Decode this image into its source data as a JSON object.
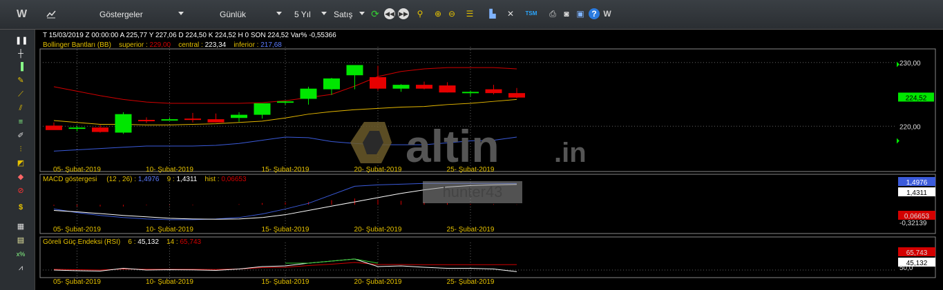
{
  "toolbar": {
    "logo": "W",
    "indicators_label": "Göstergeler",
    "period_label": "Günlük",
    "range_label": "5 Yıl",
    "price_label": "Satış",
    "icons": [
      "refresh-icon",
      "step-back-icon",
      "step-forward-icon",
      "search-icon",
      "zoom-in-icon",
      "zoom-out-icon",
      "bars-icon",
      "chart-settings-icon",
      "tools-icon",
      "tsm-icon",
      "print-icon",
      "camera-icon",
      "save-icon",
      "help-icon",
      "logo-icon"
    ],
    "tsm_label": "TSM",
    "help_label": "?",
    "end_logo": "W"
  },
  "sidebar_icons": [
    "pause-icon",
    "crosshair-icon",
    "bar-chart-icon",
    "note-icon",
    "trendline-icon",
    "channel-icon",
    "fib-icon",
    "pencil-icon",
    "signals-icon",
    "fill-icon",
    "eraser-icon",
    "no-entry-icon",
    "dollar-icon",
    "grid-icon",
    "table-icon",
    "formula-icon",
    "chart-icon"
  ],
  "sidebar_dollar": "$",
  "sidebar_formula": "x%",
  "info": {
    "date": "T 15/03/2019",
    "time": "Z 00:00:00",
    "open": "A 225,77",
    "high": "Y 227,06",
    "low": "D 224,50",
    "close": "K 224,52",
    "volume": "H 0",
    "last": "SON 224,52",
    "change": "Var% -0,55366"
  },
  "bb": {
    "name": "Bollinger Bantları (BB)",
    "superior_label": "superior :",
    "superior": "229,00",
    "central_label": "central :",
    "central": "223,34",
    "inferior_label": "inferior :",
    "inferior": "217,68"
  },
  "macd": {
    "name": "MACD göstergesi",
    "params": "(12 , 26) :",
    "macd_value": "1,4976",
    "signal_label": "9 :",
    "signal_value": "1,4311",
    "hist_label": "hist :",
    "hist_value": "0,06653"
  },
  "rsi": {
    "name": "Göreli Güç Endeksi (RSI)",
    "p1": "6 :",
    "v1": "45,132",
    "p2": "14 :",
    "v2": "65,743"
  },
  "watermark": {
    "text": "altin",
    "suffix": ".in",
    "user": "hunter43"
  },
  "colors": {
    "up": "#00e600",
    "down": "#e60000",
    "upper_band": "#d40000",
    "middle_band": "#e6b800",
    "lower_band": "#3b5bdb",
    "macd": "#3b5bdb",
    "signal": "#ffffff",
    "hist": "#d40000",
    "rsi_fast": "#ffffff",
    "rsi_slow": "#d40000",
    "rsi_over": "#2ecc2e"
  },
  "chart_data": [
    {
      "type": "candlestick",
      "title": "Bollinger Bantları (BB)",
      "x": [
        "04-Şubat-2019",
        "05-Şubat-2019",
        "06-Şubat-2019",
        "07-Şubat-2019",
        "08-Şubat-2019",
        "11-Şubat-2019",
        "12-Şubat-2019",
        "13-Şubat-2019",
        "14-Şubat-2019",
        "15-Şubat-2019",
        "18-Şubat-2019",
        "19-Şubat-2019",
        "20-Şubat-2019",
        "21-Şubat-2019",
        "22-Şubat-2019",
        "25-Şubat-2019",
        "26-Şubat-2019",
        "27-Şubat-2019",
        "28-Şubat-2019",
        "01-Mart-2019",
        "04-Mart-2019"
      ],
      "open": [
        220.1,
        219.6,
        219.8,
        219.0,
        221.0,
        221.0,
        221.2,
        221.1,
        221.3,
        221.8,
        223.7,
        224.3,
        225.8,
        228.0,
        227.7,
        225.9,
        226.5,
        226.4,
        225.3,
        225.8,
        225.2
      ],
      "high": [
        220.6,
        220.1,
        220.2,
        222.2,
        221.4,
        221.4,
        222.1,
        222.0,
        222.2,
        223.0,
        224.0,
        226.2,
        227.6,
        229.6,
        229.5,
        226.6,
        227.0,
        226.9,
        225.6,
        226.5,
        226.0
      ],
      "low": [
        219.5,
        219.2,
        219.0,
        218.8,
        220.5,
        220.9,
        220.6,
        220.6,
        220.7,
        221.2,
        223.4,
        223.4,
        224.9,
        225.8,
        225.6,
        225.4,
        225.8,
        225.3,
        224.7,
        225.0,
        224.4
      ],
      "close": [
        219.4,
        219.8,
        219.1,
        221.9,
        220.9,
        221.1,
        221.1,
        220.6,
        221.8,
        223.6,
        223.9,
        225.9,
        227.5,
        229.6,
        225.9,
        226.5,
        225.9,
        225.3,
        225.4,
        225.2,
        224.5
      ],
      "upper": [
        226.2,
        225.5,
        224.8,
        224.2,
        223.8,
        223.6,
        223.6,
        223.6,
        223.6,
        223.7,
        224.0,
        224.5,
        225.0,
        226.3,
        227.8,
        228.6,
        229.0,
        229.2,
        229.2,
        229.2,
        229.0
      ],
      "middle": [
        220.9,
        220.6,
        220.3,
        220.3,
        220.2,
        220.2,
        220.3,
        220.4,
        220.6,
        220.8,
        221.3,
        221.9,
        222.3,
        222.6,
        222.8,
        223.0,
        223.1,
        223.4,
        223.6,
        223.9,
        224.2
      ],
      "lower": [
        216.1,
        216.3,
        216.5,
        216.7,
        216.9,
        216.9,
        216.9,
        217.0,
        217.3,
        217.8,
        218.3,
        218.2,
        217.6,
        217.3,
        217.1,
        217.1,
        217.1,
        217.4,
        217.7,
        217.8,
        218.3
      ],
      "ylim": [
        214.3,
        233.0
      ],
      "yticks": [
        "230,00",
        "220,00"
      ],
      "xticks": [
        "05- Şubat-2019",
        "10- Şubat-2019",
        "15- Şubat-2019",
        "20- Şubat-2019",
        "25- Şubat-2019"
      ],
      "last_label": "224,52"
    },
    {
      "type": "line",
      "title": "MACD göstergesi",
      "macd": [
        -0.3,
        -0.55,
        -0.75,
        -0.9,
        -1.0,
        -1.05,
        -1.05,
        -1.0,
        -0.9,
        -0.65,
        -0.3,
        0.1,
        0.7,
        1.3,
        1.4,
        1.45,
        1.5,
        1.5,
        1.5,
        1.5,
        1.4976
      ],
      "signal": [
        -0.4,
        -0.5,
        -0.62,
        -0.75,
        -0.85,
        -0.95,
        -1.0,
        -1.02,
        -1.0,
        -0.9,
        -0.7,
        -0.4,
        -0.1,
        0.2,
        0.5,
        0.8,
        1.05,
        1.25,
        1.35,
        1.4,
        1.4311
      ],
      "hist": [
        -0.2,
        -0.3,
        -0.3,
        -0.3,
        -0.1,
        -0.1,
        -0.1,
        0.0,
        0.1,
        0.3,
        0.4,
        0.5,
        0.8,
        1.1,
        0.9,
        0.7,
        0.45,
        0.3,
        0.15,
        0.1,
        0.06653
      ],
      "ylim": [
        -1.2,
        1.95
      ],
      "tick_labels": [
        "1,4976",
        "1,4311",
        "0,06653",
        "-0,32139"
      ],
      "xticks": [
        "05- Şubat-2019",
        "10- Şubat-2019",
        "15- Şubat-2019",
        "20- Şubat-2019",
        "25- Şubat-2019"
      ]
    },
    {
      "type": "line",
      "title": "Göreli Güç Endeksi (RSI)",
      "rsi6": [
        50.0,
        48.0,
        47.0,
        55.0,
        50.0,
        51.0,
        50.5,
        49.0,
        53.0,
        60.0,
        62.0,
        70.0,
        76.0,
        82.0,
        60.0,
        62.0,
        58.0,
        55.0,
        55.0,
        53.0,
        45.132
      ],
      "rsi14": [
        52.0,
        51.0,
        50.0,
        53.0,
        52.0,
        52.0,
        52.0,
        51.5,
        53.0,
        57.0,
        58.0,
        63.0,
        67.0,
        72.0,
        66.0,
        66.0,
        65.5,
        65.5,
        65.5,
        65.6,
        65.743
      ],
      "ylim": [
        0,
        100
      ],
      "tick_labels": [
        "65,743",
        "45,132",
        "50,0"
      ],
      "xticks": [
        "05- Şubat-2019",
        "10- Şubat-2019",
        "15- Şubat-2019",
        "20- Şubat-2019",
        "25- Şubat-2019"
      ]
    }
  ]
}
